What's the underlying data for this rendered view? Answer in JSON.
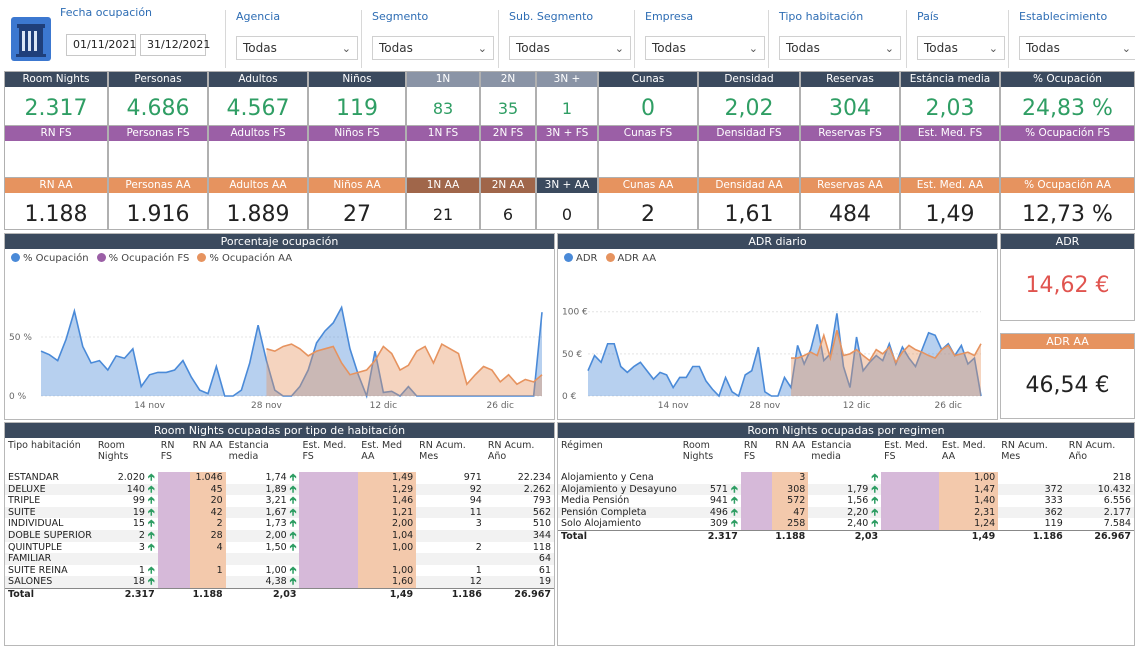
{
  "filters": {
    "fecha": {
      "label": "Fecha ocupación",
      "from": "01/11/2021",
      "to": "31/12/2021"
    },
    "slicers": [
      {
        "label": "Agencia",
        "value": "Todas"
      },
      {
        "label": "Segmento",
        "value": "Todas"
      },
      {
        "label": "Sub. Segmento",
        "value": "Todas"
      },
      {
        "label": "Empresa",
        "value": "Todas"
      },
      {
        "label": "Tipo habitación",
        "value": "Todas"
      },
      {
        "label": "País",
        "value": "Todas"
      },
      {
        "label": "Establecimiento",
        "value": "Todas"
      }
    ]
  },
  "kpis": {
    "row1": [
      {
        "label": "Room Nights",
        "value": "2.317"
      },
      {
        "label": "Personas",
        "value": "4.686"
      },
      {
        "label": "Adultos",
        "value": "4.567"
      },
      {
        "label": "Niños",
        "value": "119"
      },
      {
        "label": "1N",
        "value": "83"
      },
      {
        "label": "2N",
        "value": "35"
      },
      {
        "label": "3N +",
        "value": "1"
      },
      {
        "label": "Cunas",
        "value": "0"
      },
      {
        "label": "Densidad",
        "value": "2,02"
      },
      {
        "label": "Reservas",
        "value": "304"
      },
      {
        "label": "Estáncia media",
        "value": "2,03"
      },
      {
        "label": "% Ocupación",
        "value": "24,83 %"
      }
    ],
    "row2": [
      {
        "label": "RN FS",
        "value": ""
      },
      {
        "label": "Personas FS",
        "value": ""
      },
      {
        "label": "Adultos FS",
        "value": ""
      },
      {
        "label": "Niños FS",
        "value": ""
      },
      {
        "label": "1N FS",
        "value": ""
      },
      {
        "label": "2N FS",
        "value": ""
      },
      {
        "label": "3N + FS",
        "value": ""
      },
      {
        "label": "Cunas FS",
        "value": ""
      },
      {
        "label": "Densidad FS",
        "value": ""
      },
      {
        "label": "Reservas FS",
        "value": ""
      },
      {
        "label": "Est. Med. FS",
        "value": ""
      },
      {
        "label": "% Ocupación FS",
        "value": ""
      }
    ],
    "row3": [
      {
        "label": "RN AA",
        "value": "1.188"
      },
      {
        "label": "Personas AA",
        "value": "1.916"
      },
      {
        "label": "Adultos AA",
        "value": "1.889"
      },
      {
        "label": "Niños AA",
        "value": "27"
      },
      {
        "label": "1N AA",
        "value": "21"
      },
      {
        "label": "2N AA",
        "value": "6"
      },
      {
        "label": "3N + AA",
        "value": "0"
      },
      {
        "label": "Cunas AA",
        "value": "2"
      },
      {
        "label": "Densidad AA",
        "value": "1,61"
      },
      {
        "label": "Reservas AA",
        "value": "484"
      },
      {
        "label": "Est. Med. AA",
        "value": "1,49"
      },
      {
        "label": "% Ocupación AA",
        "value": "12,73 %"
      }
    ]
  },
  "colors": {
    "dark": "#3b4a5e",
    "purple": "#9b5fa6",
    "orange": "#e6935f",
    "blue": "#4a8ad8",
    "green": "#2f9e64",
    "red": "#e0544f"
  },
  "occ_chart": {
    "title": "Porcentaje ocupación",
    "legend": [
      "% Ocupación",
      "% Ocupación FS",
      "% Ocupación AA"
    ],
    "y_ticks": [
      "0 %",
      "50 %"
    ],
    "x_ticks": [
      "14 nov",
      "28 nov",
      "12 dic",
      "26 dic"
    ]
  },
  "adr_chart": {
    "title": "ADR diario",
    "legend": [
      "ADR",
      "ADR AA"
    ],
    "y_ticks": [
      "0 €",
      "50 €",
      "100 €"
    ],
    "x_ticks": [
      "14 nov",
      "28 nov",
      "12 dic",
      "26 dic"
    ]
  },
  "adr_card": {
    "title": "ADR",
    "value": "14,62 €"
  },
  "adr_aa_card": {
    "title": "ADR AA",
    "value": "46,54 €"
  },
  "chart_data": [
    {
      "type": "area",
      "title": "Porcentaje ocupación",
      "ylim": [
        0,
        100
      ],
      "x": [
        "01/11",
        "02/11",
        "03/11",
        "04/11",
        "05/11",
        "06/11",
        "07/11",
        "08/11",
        "09/11",
        "10/11",
        "11/11",
        "12/11",
        "13/11",
        "14/11",
        "15/11",
        "16/11",
        "17/11",
        "18/11",
        "19/11",
        "20/11",
        "21/11",
        "22/11",
        "23/11",
        "24/11",
        "25/11",
        "26/11",
        "27/11",
        "28/11",
        "29/11",
        "30/11",
        "01/12",
        "02/12",
        "03/12",
        "04/12",
        "05/12",
        "06/12",
        "07/12",
        "08/12",
        "09/12",
        "10/12",
        "11/12",
        "12/12",
        "13/12",
        "14/12",
        "15/12",
        "16/12",
        "17/12",
        "18/12",
        "19/12",
        "20/12",
        "21/12",
        "22/12",
        "23/12",
        "24/12",
        "25/12",
        "26/12",
        "27/12",
        "28/12",
        "29/12",
        "30/12",
        "31/12"
      ],
      "series": [
        {
          "name": "% Ocupación",
          "values": [
            38,
            35,
            30,
            48,
            72,
            42,
            28,
            30,
            22,
            34,
            32,
            40,
            8,
            18,
            20,
            20,
            22,
            30,
            16,
            5,
            2,
            25,
            0,
            0,
            5,
            28,
            60,
            30,
            5,
            0,
            0,
            8,
            22,
            45,
            55,
            62,
            75,
            40,
            18,
            0,
            38,
            3,
            4,
            0,
            8,
            0,
            0,
            0,
            0,
            0,
            0,
            0,
            0,
            0,
            0,
            0,
            0,
            0,
            0,
            0,
            71
          ]
        },
        {
          "name": "% Ocupación AA",
          "values": [
            null,
            null,
            null,
            null,
            null,
            null,
            null,
            null,
            null,
            null,
            null,
            null,
            null,
            null,
            null,
            null,
            null,
            null,
            null,
            null,
            null,
            null,
            null,
            null,
            null,
            null,
            null,
            40,
            38,
            42,
            44,
            40,
            34,
            38,
            40,
            42,
            28,
            18,
            20,
            22,
            30,
            42,
            36,
            22,
            26,
            38,
            42,
            28,
            44,
            40,
            36,
            10,
            18,
            25,
            22,
            12,
            18,
            10,
            14,
            12,
            18
          ]
        }
      ]
    },
    {
      "type": "area",
      "title": "ADR diario",
      "ylim": [
        0,
        140
      ],
      "x": [
        "01/11",
        "02/11",
        "03/11",
        "04/11",
        "05/11",
        "06/11",
        "07/11",
        "08/11",
        "09/11",
        "10/11",
        "11/11",
        "12/11",
        "13/11",
        "14/11",
        "15/11",
        "16/11",
        "17/11",
        "18/11",
        "19/11",
        "20/11",
        "21/11",
        "22/11",
        "23/11",
        "24/11",
        "25/11",
        "26/11",
        "27/11",
        "28/11",
        "29/11",
        "30/11",
        "01/12",
        "02/12",
        "03/12",
        "04/12",
        "05/12",
        "06/12",
        "07/12",
        "08/12",
        "09/12",
        "10/12",
        "11/12",
        "12/12",
        "13/12",
        "14/12",
        "15/12",
        "16/12",
        "17/12",
        "18/12",
        "19/12",
        "20/12",
        "21/12",
        "22/12",
        "23/12",
        "24/12",
        "25/12",
        "26/12",
        "27/12",
        "28/12",
        "29/12",
        "30/12",
        "31/12"
      ],
      "series": [
        {
          "name": "ADR",
          "values": [
            30,
            48,
            40,
            62,
            62,
            35,
            28,
            35,
            40,
            30,
            20,
            28,
            25,
            10,
            22,
            22,
            35,
            35,
            18,
            8,
            0,
            22,
            5,
            0,
            25,
            30,
            58,
            5,
            0,
            0,
            22,
            10,
            60,
            38,
            55,
            85,
            42,
            50,
            98,
            35,
            10,
            70,
            30,
            40,
            48,
            42,
            62,
            38,
            58,
            45,
            35,
            55,
            75,
            72,
            55,
            62,
            48,
            60,
            38,
            45,
            0
          ]
        },
        {
          "name": "ADR AA",
          "values": [
            null,
            null,
            null,
            null,
            null,
            null,
            null,
            null,
            null,
            null,
            null,
            null,
            null,
            null,
            null,
            null,
            null,
            null,
            null,
            null,
            null,
            null,
            null,
            null,
            null,
            null,
            null,
            null,
            null,
            null,
            null,
            45,
            45,
            48,
            52,
            48,
            72,
            45,
            78,
            48,
            50,
            55,
            48,
            42,
            55,
            50,
            58,
            40,
            52,
            60,
            55,
            52,
            48,
            45,
            55,
            60,
            48,
            50,
            52,
            48,
            62
          ]
        }
      ]
    }
  ],
  "table_tipo": {
    "title": "Room Nights ocupadas por tipo de habitación",
    "headers": [
      "Tipo habitación",
      "Room Nights",
      "RN FS",
      "RN AA",
      "Estancia media",
      "Est. Med. FS",
      "Est. Med AA",
      "RN Acum. Mes",
      "RN Acum. Año"
    ],
    "rows": [
      [
        "ESTANDAR",
        "2.020",
        "",
        "1.046",
        "1,74",
        "",
        "1,49",
        "971",
        "22.234"
      ],
      [
        "DELUXE",
        "140",
        "",
        "45",
        "1,89",
        "",
        "1,29",
        "92",
        "2.262"
      ],
      [
        "TRIPLE",
        "99",
        "",
        "20",
        "3,21",
        "",
        "1,46",
        "94",
        "793"
      ],
      [
        "SUITE",
        "19",
        "",
        "42",
        "1,67",
        "",
        "1,21",
        "11",
        "562"
      ],
      [
        "INDIVIDUAL",
        "15",
        "",
        "2",
        "1,73",
        "",
        "2,00",
        "3",
        "510"
      ],
      [
        "DOBLE SUPERIOR",
        "2",
        "",
        "28",
        "2,00",
        "",
        "1,04",
        "",
        "344"
      ],
      [
        "QUINTUPLE",
        "3",
        "",
        "4",
        "1,50",
        "",
        "1,00",
        "2",
        "118"
      ],
      [
        "FAMILIAR",
        "",
        "",
        "",
        "",
        "",
        "",
        "",
        "64"
      ],
      [
        "SUITE REINA",
        "1",
        "",
        "1",
        "1,00",
        "",
        "1,00",
        "1",
        "61"
      ],
      [
        "SALONES",
        "18",
        "",
        "",
        "4,38",
        "",
        "1,60",
        "12",
        "19"
      ]
    ],
    "total": [
      "Total",
      "2.317",
      "",
      "1.188",
      "2,03",
      "",
      "1,49",
      "1.186",
      "26.967"
    ]
  },
  "table_regimen": {
    "title": "Room Nights ocupadas por regimen",
    "headers": [
      "Régimen",
      "Room Nights",
      "RN FS",
      "RN AA",
      "Estancia media",
      "Est. Med. FS",
      "Est. Med. AA",
      "RN Acum. Mes",
      "RN Acum. Año"
    ],
    "rows": [
      [
        "Alojamiento y Cena",
        "",
        "",
        "3",
        "",
        "",
        "1,00",
        "",
        "218"
      ],
      [
        "Alojamiento y Desayuno",
        "571",
        "",
        "308",
        "1,79",
        "",
        "1,47",
        "372",
        "10.432"
      ],
      [
        "Media Pensión",
        "941",
        "",
        "572",
        "1,56",
        "",
        "1,40",
        "333",
        "6.556"
      ],
      [
        "Pensión Completa",
        "496",
        "",
        "47",
        "2,20",
        "",
        "2,31",
        "362",
        "2.177"
      ],
      [
        "Solo Alojamiento",
        "309",
        "",
        "258",
        "2,40",
        "",
        "1,24",
        "119",
        "7.584"
      ]
    ],
    "total": [
      "Total",
      "2.317",
      "",
      "1.188",
      "2,03",
      "",
      "1,49",
      "1.186",
      "26.967"
    ]
  }
}
